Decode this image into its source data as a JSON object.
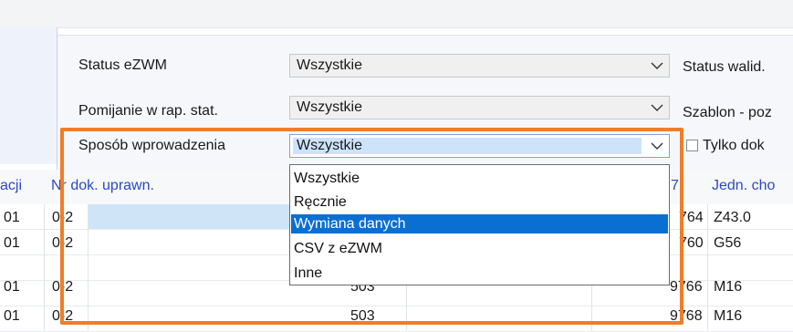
{
  "filters": {
    "status_ezwm": {
      "label": "Status eZWM",
      "value": "Wszystkie"
    },
    "pomijanie": {
      "label": "Pomijanie w rap. stat.",
      "value": "Wszystkie"
    },
    "sposob": {
      "label": "Sposób wprowadzenia",
      "value": "Wszystkie"
    },
    "right_labels": {
      "status_walid": "Status walid.",
      "szablon": "Szablon - poz",
      "tylko": "Tylko dok"
    }
  },
  "dropdown": {
    "options": [
      "Wszystkie",
      "Ręcznie",
      "Wymiana danych",
      "CSV z eZWM",
      "Inne"
    ],
    "highlighted": "Wymiana danych"
  },
  "grid": {
    "headers": {
      "c1": "acji",
      "c2": "Nr dok. uprawn.",
      "c_partial": "7",
      "c_last": "Jedn. cho"
    },
    "rows": [
      {
        "c1": "01",
        "c2": "0-2",
        "mid": "",
        "right": "764",
        "last": "Z43.0"
      },
      {
        "c1": "01",
        "c2": "0-2",
        "mid": "",
        "right": "760",
        "last": "G56"
      },
      {
        "c1": "01",
        "c2": "0-2",
        "mid": "503",
        "right": "9766",
        "last": "M16"
      },
      {
        "c1": "01",
        "c2": "0-2",
        "mid": "503",
        "right": "9768",
        "last": "M16"
      }
    ]
  },
  "colors": {
    "accent_orange": "#f07d2a",
    "highlight_blue": "#0a6fd2",
    "header_text": "#2b48c8"
  }
}
